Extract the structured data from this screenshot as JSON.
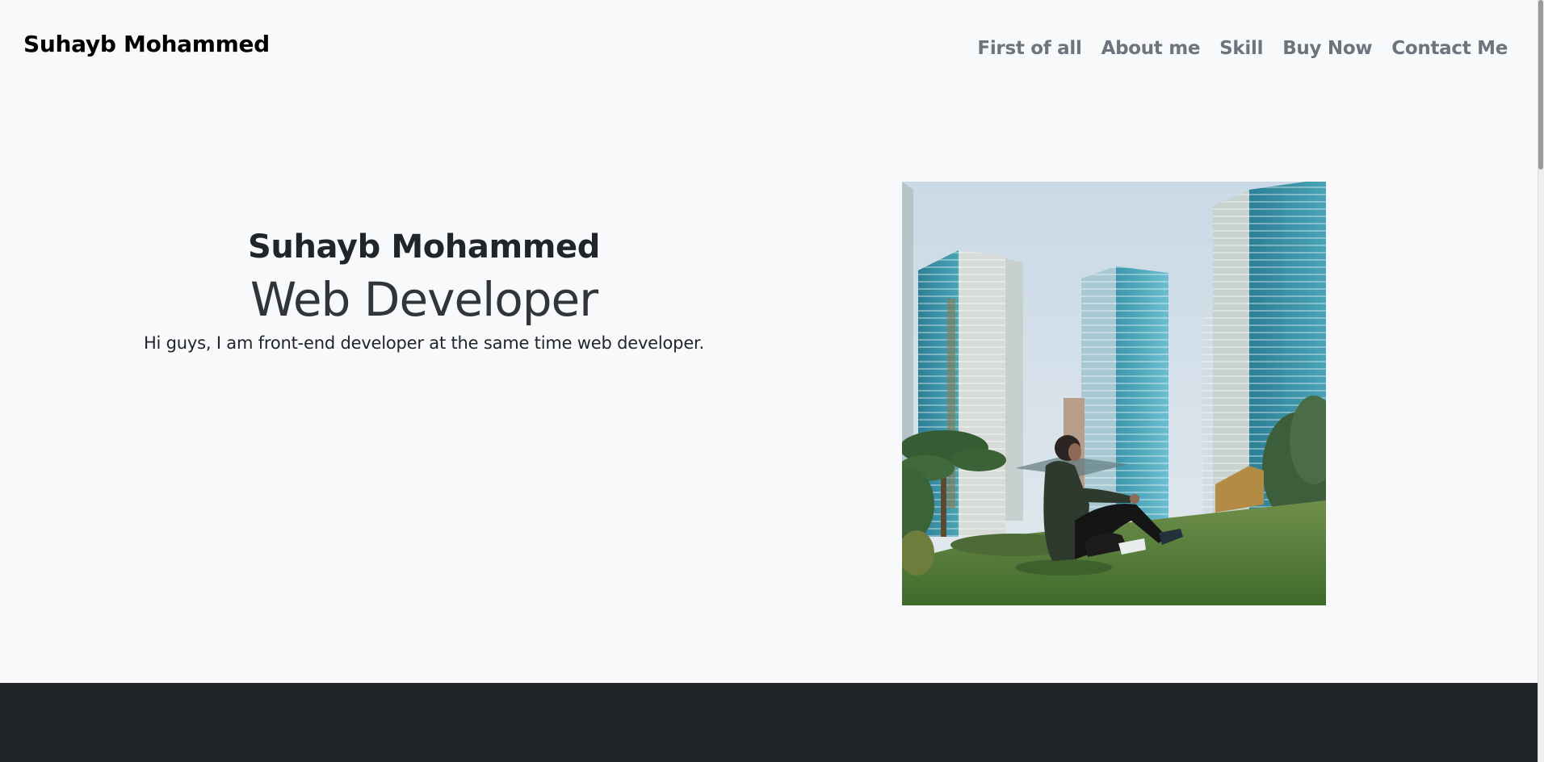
{
  "navbar": {
    "brand": "Suhayb Mohammed",
    "links": [
      {
        "label": "First of all"
      },
      {
        "label": "About me"
      },
      {
        "label": "Skill"
      },
      {
        "label": "Buy Now"
      },
      {
        "label": "Contact Me"
      }
    ]
  },
  "hero": {
    "name": "Suhayb Mohammed",
    "role": "Web Developer",
    "description": "Hi guys, I am front-end developer at the same time web developer."
  },
  "photo": {
    "subject": "man sitting on grass in front of high-rise buildings"
  },
  "colors": {
    "background": "#f8f9fa",
    "nav_link": "#6c757d",
    "text": "#212529",
    "footer": "#212529"
  }
}
